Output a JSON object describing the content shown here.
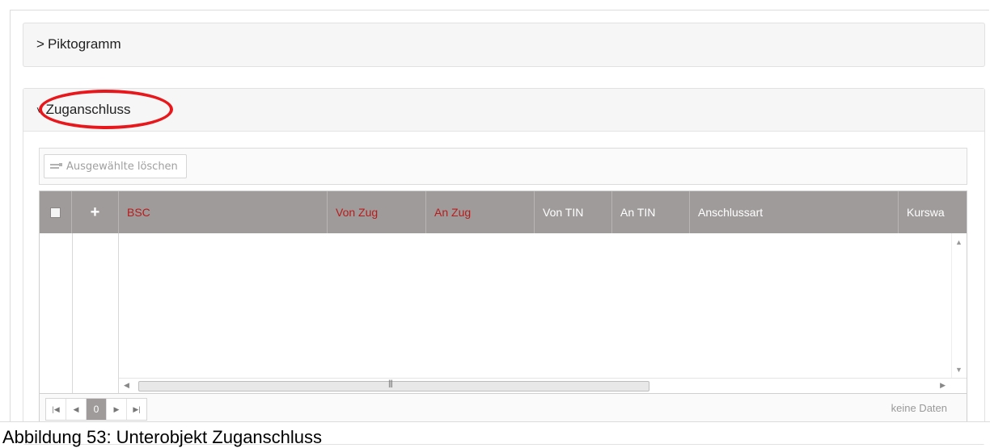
{
  "panels": {
    "piktogramm": {
      "chevron": ">",
      "title": "Piktogramm"
    },
    "zuganschluss": {
      "chevron": "˅",
      "title": "Zuganschluss"
    }
  },
  "toolbar": {
    "delete_selected_label": "Ausgewählte löschen"
  },
  "grid": {
    "add_symbol": "+",
    "columns": [
      "BSC",
      "Von Zug",
      "An Zug",
      "Von TIN",
      "An TIN",
      "Anschlussart",
      "Kurswa"
    ],
    "required_color": "#b71c1c",
    "header_color": "#a09b9b",
    "rows": []
  },
  "pager": {
    "current_page": "0",
    "info": "keine Daten"
  },
  "caption": "Abbildung 53: Unterobjekt Zuganschluss",
  "annotation_color": "#e8171c"
}
